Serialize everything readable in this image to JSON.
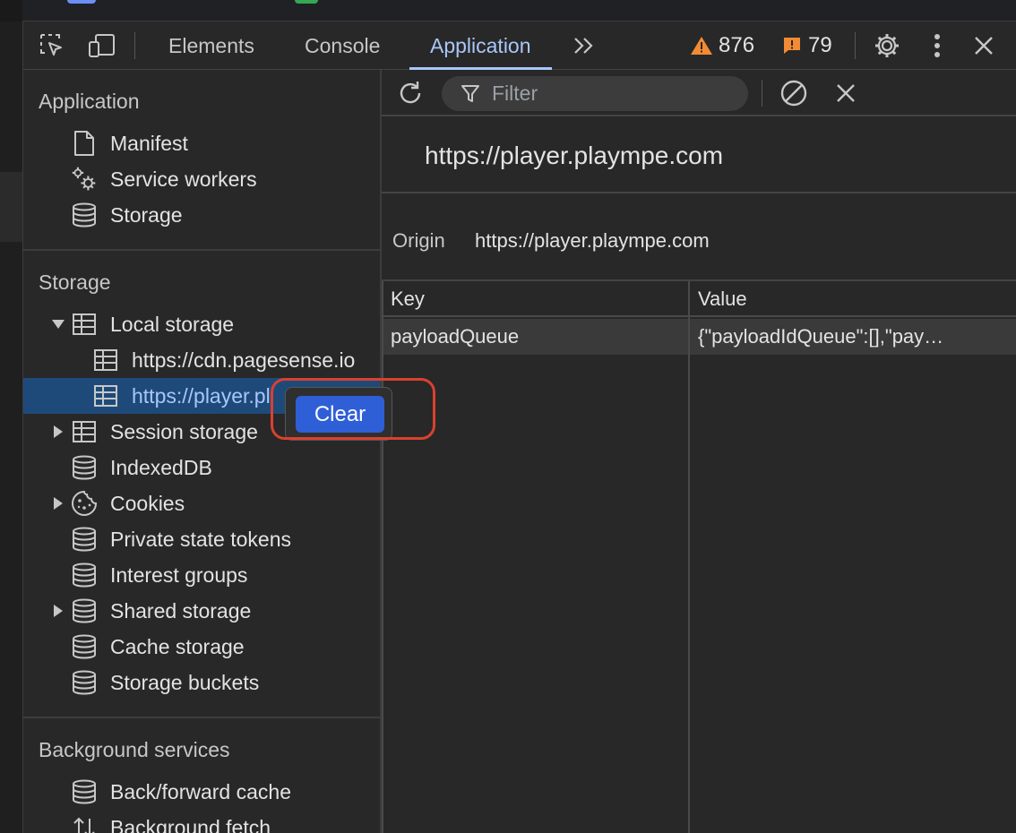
{
  "toolbar": {
    "tabs": [
      {
        "label": "Elements"
      },
      {
        "label": "Console"
      },
      {
        "label": "Application"
      }
    ],
    "more_tabs_label": ">>",
    "warnings_count": "876",
    "errors_count": "79"
  },
  "sidebar": {
    "application_section": {
      "title": "Application",
      "items": [
        {
          "label": "Manifest",
          "icon": "document-icon"
        },
        {
          "label": "Service workers",
          "icon": "gears-icon"
        },
        {
          "label": "Storage",
          "icon": "database-icon"
        }
      ]
    },
    "storage_section": {
      "title": "Storage",
      "local_storage": {
        "label": "Local storage",
        "expanded": true,
        "children": [
          {
            "label": "https://cdn.pagesense.io"
          },
          {
            "label": "https://player.pl",
            "selected": true
          }
        ]
      },
      "items": [
        {
          "label": "Session storage",
          "icon": "table-icon",
          "expandable": true
        },
        {
          "label": "IndexedDB",
          "icon": "database-icon",
          "expandable": false
        },
        {
          "label": "Cookies",
          "icon": "cookie-icon",
          "expandable": true
        },
        {
          "label": "Private state tokens",
          "icon": "database-icon",
          "expandable": false
        },
        {
          "label": "Interest groups",
          "icon": "database-icon",
          "expandable": false
        },
        {
          "label": "Shared storage",
          "icon": "database-icon",
          "expandable": true
        },
        {
          "label": "Cache storage",
          "icon": "database-icon",
          "expandable": false
        },
        {
          "label": "Storage buckets",
          "icon": "database-icon",
          "expandable": false
        }
      ]
    },
    "background_section": {
      "title": "Background services",
      "items": [
        {
          "label": "Back/forward cache",
          "icon": "database-icon"
        },
        {
          "label": "Background fetch",
          "icon": "up-down-arrows-icon"
        }
      ]
    }
  },
  "main": {
    "filter_placeholder": "Filter",
    "origin_title": "https://player.plaympe.com",
    "origin_label": "Origin",
    "origin_value": "https://player.plaympe.com",
    "table": {
      "columns": [
        "Key",
        "Value"
      ],
      "rows": [
        {
          "key": "payloadQueue",
          "value": "{\"payloadIdQueue\":[],\"pay…"
        }
      ]
    }
  },
  "context_menu": {
    "clear_label": "Clear"
  },
  "colors": {
    "accent": "#a8c7fa",
    "selection": "#1e4a7a",
    "clear_button": "#2f5fd6",
    "highlight_ring": "#d9412f",
    "warning": "#f28b34",
    "error": "#f28b34"
  }
}
